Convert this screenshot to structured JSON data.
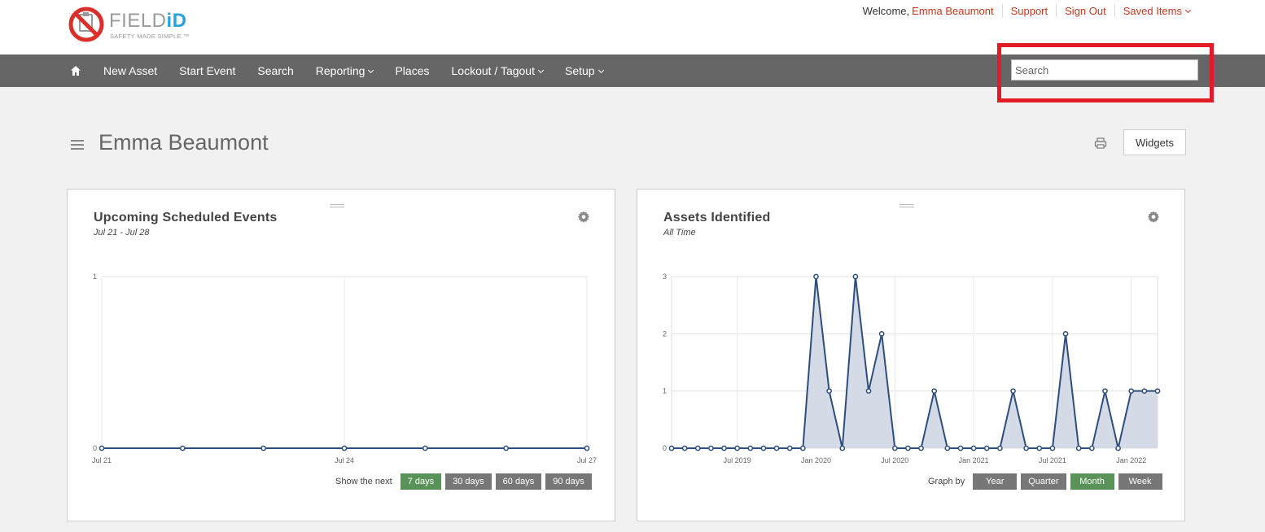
{
  "header": {
    "logo": {
      "name": "FIELD",
      "name_accent": "iD",
      "tagline": "SAFETY MADE SIMPLE.™"
    },
    "welcome": "Welcome,",
    "user": "Emma Beaumont",
    "links": {
      "support": "Support",
      "signout": "Sign Out",
      "saved": "Saved Items"
    }
  },
  "nav": {
    "items": [
      "New Asset",
      "Start Event",
      "Search",
      "Reporting",
      "Places",
      "Lockout / Tagout",
      "Setup"
    ],
    "search_placeholder": "Search",
    "highlight_color": "#e21b24"
  },
  "page": {
    "title": "Emma Beaumont",
    "widgets_label": "Widgets"
  },
  "widgets": [
    {
      "title": "Upcoming Scheduled Events",
      "subtitle": "Jul 21 - Jul 28",
      "controls_label": "Show the next",
      "buttons": [
        "7 days",
        "30 days",
        "60 days",
        "90 days"
      ],
      "active": "7 days"
    },
    {
      "title": "Assets Identified",
      "subtitle": "All Time",
      "controls_label": "Graph by",
      "buttons": [
        "Year",
        "Quarter",
        "Month",
        "Week"
      ],
      "active": "Month"
    }
  ],
  "chart_data": [
    {
      "type": "line",
      "x": [
        "Jul 21",
        "Jul 22",
        "Jul 23",
        "Jul 24",
        "Jul 25",
        "Jul 26",
        "Jul 27"
      ],
      "x_tick_labels": [
        "Jul 21",
        "Jul 24",
        "Jul 27"
      ],
      "series": [
        {
          "values": [
            0,
            0,
            0,
            0,
            0,
            0,
            0
          ]
        }
      ],
      "ylim": [
        0,
        1
      ],
      "y_ticks": [
        0,
        1
      ],
      "grid": true,
      "color": "#2e4e7e"
    },
    {
      "type": "area",
      "x": [
        "2019-02",
        "2019-03",
        "2019-04",
        "2019-05",
        "2019-06",
        "2019-07",
        "2019-08",
        "2019-09",
        "2019-10",
        "2019-11",
        "2019-12",
        "2020-01",
        "2020-02",
        "2020-03",
        "2020-04",
        "2020-05",
        "2020-06",
        "2020-07",
        "2020-08",
        "2020-09",
        "2020-10",
        "2020-11",
        "2020-12",
        "2021-01",
        "2021-02",
        "2021-03",
        "2021-04",
        "2021-05",
        "2021-06",
        "2021-07",
        "2021-08",
        "2021-09",
        "2021-10",
        "2021-11",
        "2021-12",
        "2022-01",
        "2022-02",
        "2022-03"
      ],
      "x_tick_labels": [
        "Jul 2019",
        "Jan 2020",
        "Jul 2020",
        "Jan 2021",
        "Jul 2021",
        "Jan 2022"
      ],
      "series": [
        {
          "values": [
            0,
            0,
            0,
            0,
            0,
            0,
            0,
            0,
            0,
            0,
            0,
            3,
            1,
            0,
            3,
            1,
            2,
            0,
            0,
            0,
            1,
            0,
            0,
            0,
            0,
            0,
            1,
            0,
            0,
            0,
            2,
            0,
            0,
            1,
            0,
            1,
            1,
            1
          ]
        }
      ],
      "ylim": [
        0,
        3
      ],
      "y_ticks": [
        0,
        1,
        2,
        3
      ],
      "grid": true,
      "color": "#2e4e7e",
      "fill": "#d4dbe7"
    }
  ]
}
